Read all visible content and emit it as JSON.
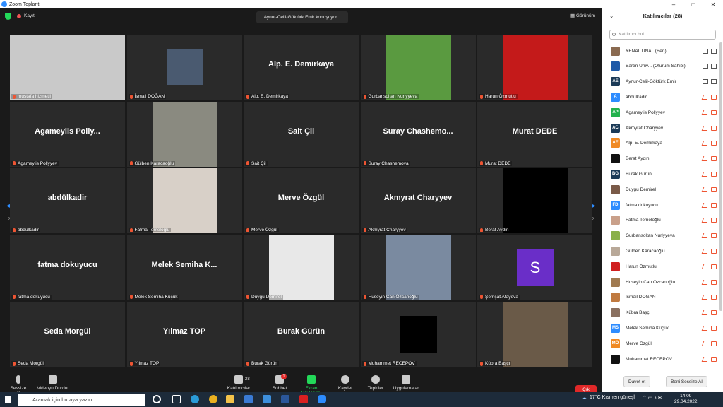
{
  "window": {
    "title": "Zoom Toplantı",
    "minimize": "–",
    "maximize": "□",
    "close": "✕"
  },
  "topbar": {
    "record_label": "Kayıt",
    "speaking": "Aynur-Celil-Göktürk Emir konuşuyor...",
    "view_label": "Görünüm"
  },
  "grid": {
    "page_left": "2/2",
    "page_right": "2/2",
    "tiles": [
      {
        "label": "mustafa hizmetli",
        "big": "",
        "photo": true
      },
      {
        "label": "İsmail DOĞAN",
        "big": "",
        "photo": true
      },
      {
        "label": "Alp. E. Demirkaya",
        "big": "Alp. E. Demirkaya",
        "photo": false
      },
      {
        "label": "Gurbansoltan Nurlyyeva",
        "big": "",
        "photo": true
      },
      {
        "label": "Harun Özmutlu",
        "big": "",
        "photo": true
      },
      {
        "label": "Agameylis Pollyyev",
        "big": "Agameylis Polly...",
        "photo": false
      },
      {
        "label": "Gülben Karacaoğlu",
        "big": "",
        "photo": true
      },
      {
        "label": "Sait Çil",
        "big": "Sait Çil",
        "photo": false
      },
      {
        "label": "Suray Chashemova",
        "big": "Suray Chashemo...",
        "photo": false
      },
      {
        "label": "Murat DEDE",
        "big": "Murat DEDE",
        "photo": false
      },
      {
        "label": "abdülkadir",
        "big": "abdülkadir",
        "photo": false
      },
      {
        "label": "Fatma Temeloğlu",
        "big": "",
        "photo": true
      },
      {
        "label": "Merve Özgül",
        "big": "Merve Özgül",
        "photo": false
      },
      {
        "label": "Akmyrat Charyyev",
        "big": "Akmyrat Charyyev",
        "photo": false
      },
      {
        "label": "Berat Aydın",
        "big": "",
        "photo": true
      },
      {
        "label": "fatma dokuyucu",
        "big": "fatma dokuyucu",
        "photo": false
      },
      {
        "label": "Melek Semiha Küçük",
        "big": "Melek Semiha K...",
        "photo": false
      },
      {
        "label": "Duygu Demirel",
        "big": "",
        "photo": true
      },
      {
        "label": "Huseyin Can Özcanoğlu",
        "big": "",
        "photo": true
      },
      {
        "label": "Şemşat Atayeva",
        "big": "S",
        "photo": false
      },
      {
        "label": "Seda Morgül",
        "big": "Seda Morgül",
        "photo": false
      },
      {
        "label": "Yılmaz TOP",
        "big": "Yılmaz TOP",
        "photo": false
      },
      {
        "label": "Burak Gürün",
        "big": "Burak Gürün",
        "photo": false
      },
      {
        "label": "Muhammet RECEPOV",
        "big": "",
        "photo": true
      },
      {
        "label": "Kübra Başçı",
        "big": "",
        "photo": true
      }
    ]
  },
  "toolbar": {
    "mute": "Sessize al",
    "video": "Videoyu Durdur",
    "participants": "Katılımcılar",
    "participants_count": "28",
    "chat": "Sohbet",
    "chat_badge": "1",
    "share": "Ekran Paylaşımı",
    "record": "Kaydet",
    "reactions": "Tepkiler",
    "apps": "Uygulamalar",
    "leave": "Çık"
  },
  "panel": {
    "title": "Katılımcılar (28)",
    "search_placeholder": "Katılımcı bul",
    "participants": [
      {
        "name": "YENAL ÜNAL (Ben)",
        "initials": "",
        "color": "#8a6a50"
      },
      {
        "name": "Bartın Üniv... (Oturum Sahibi)",
        "initials": "",
        "color": "#1e5aa8"
      },
      {
        "name": "Aynur-Celil-Göktürk Emir",
        "initials": "AE",
        "color": "#1b3a57"
      },
      {
        "name": "abdülkadir",
        "initials": "A",
        "color": "#2d8cff"
      },
      {
        "name": "Agameylis Pollyyev",
        "initials": "AP",
        "color": "#23b14d"
      },
      {
        "name": "Akmyrat Charyyev",
        "initials": "AC",
        "color": "#1b3a57"
      },
      {
        "name": "Alp. E. Demirkaya",
        "initials": "AE",
        "color": "#f08a24"
      },
      {
        "name": "Berat Aydın",
        "initials": "",
        "color": "#111111"
      },
      {
        "name": "Burak Gürün",
        "initials": "BG",
        "color": "#1b3a57"
      },
      {
        "name": "Duygu Demirel",
        "initials": "",
        "color": "#7a5a48"
      },
      {
        "name": "fatma dokuyucu",
        "initials": "FD",
        "color": "#2d8cff"
      },
      {
        "name": "Fatma Temeloğlu",
        "initials": "",
        "color": "#c9a08a"
      },
      {
        "name": "Gurbansoltan Nurlyyeva",
        "initials": "",
        "color": "#8ab04a"
      },
      {
        "name": "Gülben Karacaoğlu",
        "initials": "",
        "color": "#b8a898"
      },
      {
        "name": "Harun Özmutlu",
        "initials": "",
        "color": "#d02020"
      },
      {
        "name": "Huseyin Can Özcanoğlu",
        "initials": "",
        "color": "#a07a50"
      },
      {
        "name": "İsmail DOĞAN",
        "initials": "",
        "color": "#c07a40"
      },
      {
        "name": "Kübra Başçı",
        "initials": "",
        "color": "#8a7060"
      },
      {
        "name": "Melek Semiha Küçük",
        "initials": "MS",
        "color": "#2d8cff"
      },
      {
        "name": "Merve Özgül",
        "initials": "MÖ",
        "color": "#f08a24"
      },
      {
        "name": "Muhammet RECEPOV",
        "initials": "",
        "color": "#111111"
      }
    ],
    "invite": "Davet et",
    "mute_all": "Beni Sessize Al"
  },
  "taskbar": {
    "search_placeholder": "Aramak için buraya yazın",
    "weather": "17°C  Kısmen güneşli",
    "time": "14:09",
    "date": "29.04.2022"
  }
}
